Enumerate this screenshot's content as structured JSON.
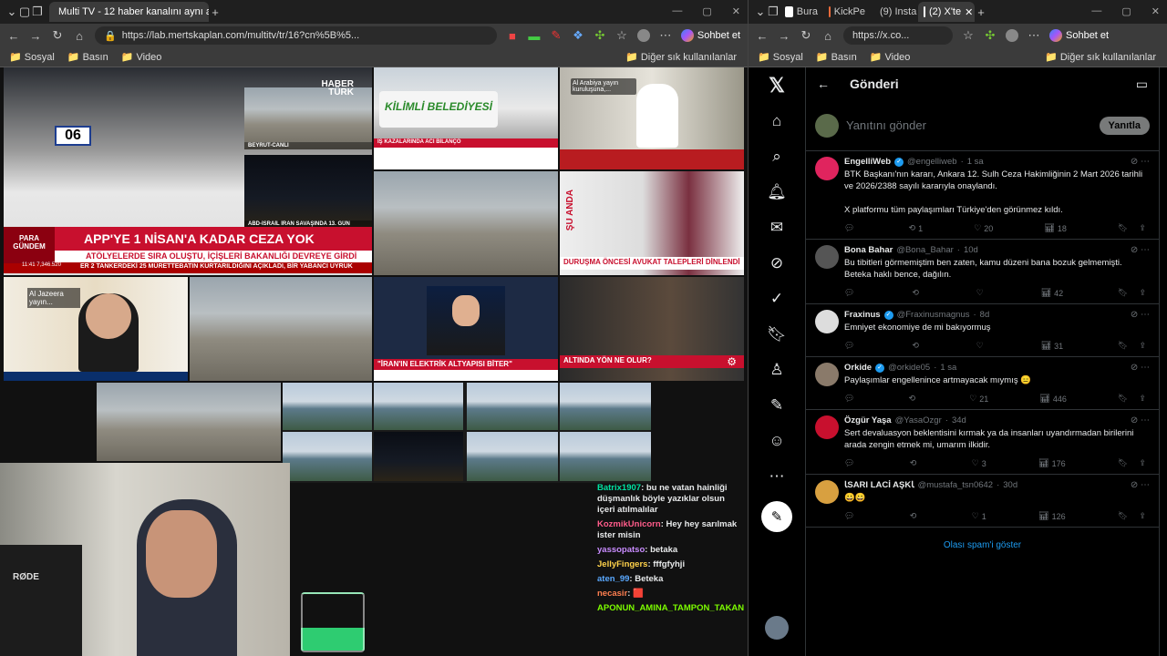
{
  "left": {
    "tab_title": "Multi TV - 12 haber kanalını aynı a",
    "url": "https://lab.mertskaplan.com/multitv/tr/16?cn%5B%5...",
    "sohbet": "Sohbet et",
    "bookmarks": [
      "Sosyal",
      "Basın",
      "Video"
    ],
    "other_bookmarks": "Diğer sık kullanılanlar",
    "streams": {
      "haberturk": "HABER TÜRK",
      "para_gundem": "PARA\nGÜNDEM",
      "headline": "APP'YE 1 NİSAN'A KADAR CEZA YOK",
      "sub1": "ATÖLYELERDE SIRA OLUŞTU, İÇİŞLERİ BAKANLIĞI DEVREYE GİRDİ",
      "ticker": "ER 2 TANKERDEKİ 25 MÜRETTEBATIN KURTARILDIĞINI AÇIKLADI, BİR YABANCI UYRUK",
      "plate": "06",
      "beyrut": "BEYRUT-CANLI",
      "abd_iran": "ABD-İSRAİL İRAN SAVAŞINDA 13. GÜN",
      "kilimli": "KİLİMLİ BELEDİYESİ",
      "kazalarinda": "İŞ KAZALARINDA ACI BİLANÇO",
      "alarabiya": "Al Arabiya yayın kuruluşuna,...",
      "su_anda": "ŞU ANDA",
      "durusma": "DURUŞMA ÖNCESİ AVUKAT TALEPLERİ DİNLENDİ",
      "aljazeera": "Al Jazeera yayın...",
      "iran_elektrik": "\"İRAN'IN ELEKTRİK ALTYAPISI BİTER\"",
      "altinda": "ALTINDA YÖN NE OLUR?",
      "ntv_time": "11:41",
      "ntv_value": "7,346.520"
    },
    "chat": [
      {
        "user": "Batrix1907",
        "msg": "bu ne vatan hainliği düşmanlık böyle yazıklar olsun içeri atılmalılar"
      },
      {
        "user": "KozmikUnicorn",
        "msg": "Hey hey sarılmak ister misin"
      },
      {
        "user": "yassopatso",
        "msg": "betaka"
      },
      {
        "user": "JellyFingers",
        "msg": "fffgfyhji"
      },
      {
        "user": "aten_99",
        "msg": "Beteka"
      },
      {
        "user": "necasir",
        "msg": "🟥"
      },
      {
        "user": "",
        "msg": "APONUN_AMINA_TAMPON_TAKAN"
      }
    ],
    "mic_brand": "RØDE"
  },
  "right": {
    "tabs": [
      "Bura",
      "KickPe",
      "(9) Insta",
      "(2) X'te"
    ],
    "url": "https://x.co...",
    "sohbet": "Sohbet et",
    "bookmarks": [
      "Sosyal",
      "Basın",
      "Video"
    ],
    "other_bookmarks": "Diğer sık kullanılanlar",
    "header_title": "Gönderi",
    "reply_placeholder": "Yanıtını gönder",
    "reply_button": "Yanıtla",
    "posts": [
      {
        "name": "EngelliWeb",
        "handle": "@engelliweb",
        "time": "1 sa",
        "verified": true,
        "text": "BTK Başkanı'nın kararı, Ankara 12. Sulh Ceza Hakimliğinin 2 Mart 2026 tarihli ve 2026/2388 sayılı kararıyla onaylandı.\n\nX platformu tüm paylaşımları Türkiye'den görünmez kıldı.",
        "replies": "",
        "reposts": "1",
        "likes": "20",
        "views": "18",
        "avatar": "#e0245e"
      },
      {
        "name": "Bona Bahar",
        "handle": "@Bona_Bahar",
        "time": "10d",
        "verified": false,
        "text": "Bu tibitleri görmemiştim ben zaten, kamu düzeni bana bozuk gelmemişti. Beteka haklı bence, dağılın.",
        "replies": "",
        "reposts": "",
        "likes": "",
        "views": "42",
        "avatar": "#555"
      },
      {
        "name": "Fraxinus",
        "handle": "@Fraxinusmagnus",
        "time": "8d",
        "verified": true,
        "text": "Emniyet ekonomiye de mi bakıyormuş",
        "replies": "",
        "reposts": "",
        "likes": "",
        "views": "31",
        "avatar": "#ddd"
      },
      {
        "name": "Orkide",
        "handle": "@orkide05",
        "time": "1 sa",
        "verified": true,
        "text": "Paylaşımlar engellenince artmayacak mıymış 😑",
        "replies": "",
        "reposts": "",
        "likes": "21",
        "views": "446",
        "avatar": "#8a7a6a"
      },
      {
        "name": "Özgür Yaşa",
        "handle": "@YasaOzgr",
        "time": "34d",
        "verified": false,
        "text": "Sert devaluasyon beklentisini kırmak ya da insanları uyandırmadan birilerini arada zengin etmek mi, umarım ilkidir.",
        "replies": "",
        "reposts": "",
        "likes": "3",
        "views": "176",
        "avatar": "#c8102e"
      },
      {
        "name": "ꙆSARI LACİ AŞKꙆ",
        "handle": "@mustafa_tsn0642",
        "time": "30d",
        "verified": false,
        "text": "😀😀",
        "replies": "",
        "reposts": "",
        "likes": "1",
        "views": "126",
        "avatar": "#d8a040"
      }
    ],
    "spam_link": "Olası spam'i göster"
  },
  "colors": {
    "x_blue": "#1d9bf0",
    "x_bg": "#000000",
    "browser_chrome": "#3b3b3b"
  }
}
